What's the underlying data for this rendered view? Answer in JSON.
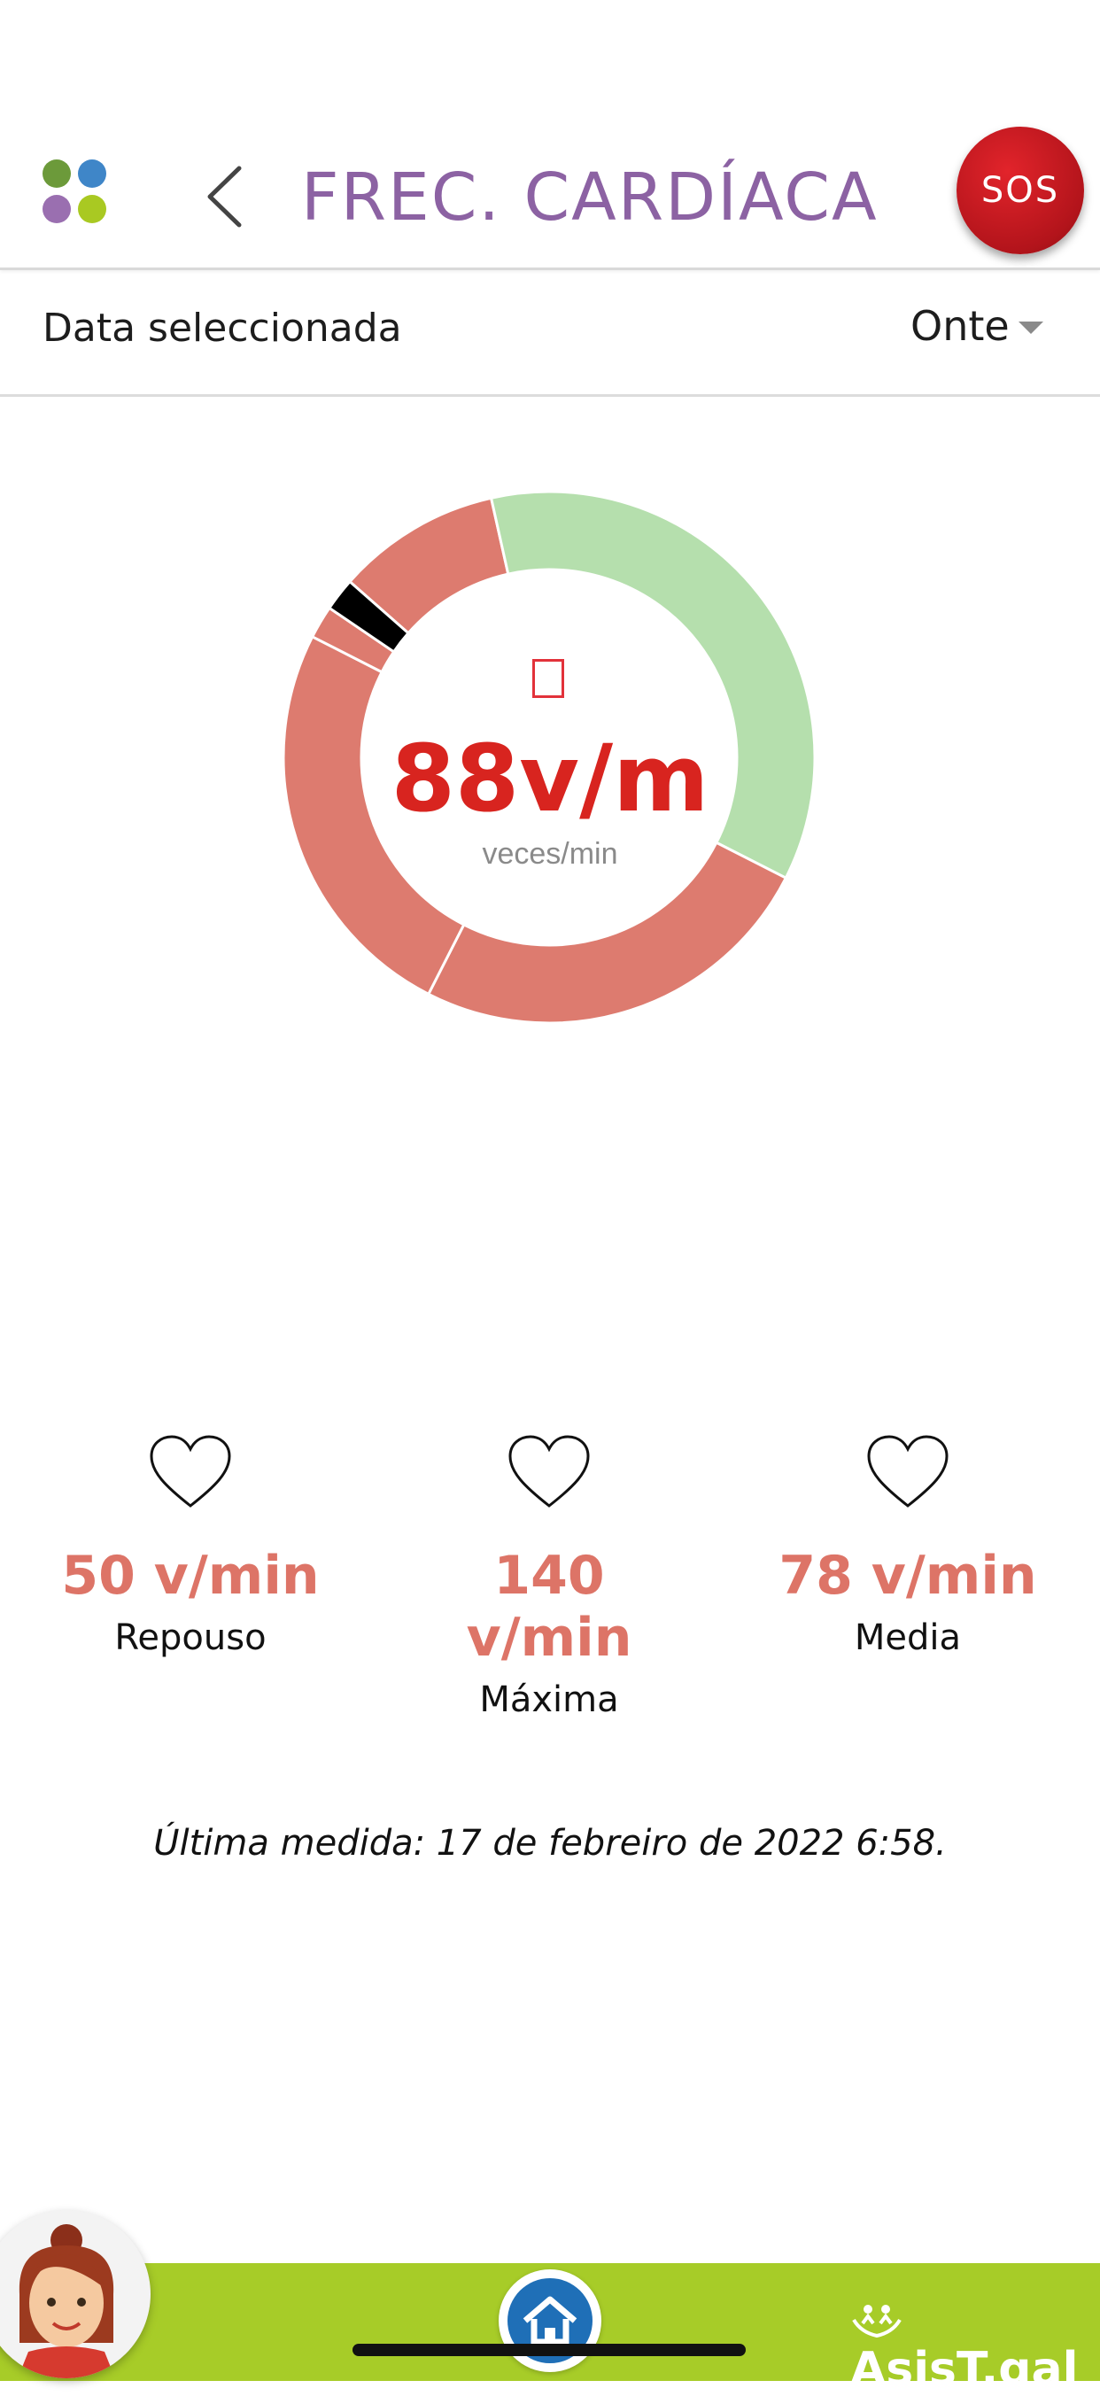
{
  "header": {
    "title": "FREC. CARDÍACA",
    "sos_label": "SOS",
    "app_dots_colors": [
      "#6c9a3a",
      "#3f86c8",
      "#9a6fb0",
      "#a9c922"
    ]
  },
  "date_filter": {
    "label": "Data seleccionada",
    "selected": "Onte"
  },
  "gauge": {
    "value_text": "88v/m",
    "unit_text": "veces/min"
  },
  "chart_data": {
    "type": "pie",
    "values": [
      10,
      36,
      25,
      25,
      2,
      2
    ],
    "colors": [
      "#dd7b6f",
      "#b5dfad",
      "#dd7b6f",
      "#dd7b6f",
      "#dd7b6f",
      "#000000"
    ]
  },
  "stats": [
    {
      "value": "50 v/min",
      "label": "Repouso"
    },
    {
      "value": "140 v/min",
      "label": "Máxima"
    },
    {
      "value": "78 v/min",
      "label": "Media"
    }
  ],
  "last_measure": "Última medida: 17 de febreiro de 2022 6:58.",
  "bottom_bar": {
    "brand": "AsisT.gal",
    "bar_color": "#a7cc28"
  }
}
